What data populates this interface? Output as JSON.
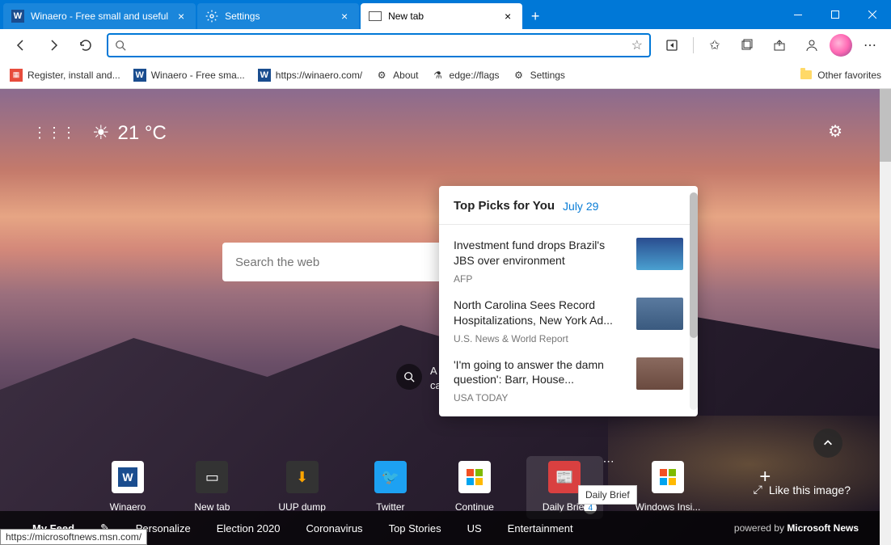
{
  "titlebar": {
    "tabs": [
      {
        "label": "Winaero - Free small and useful",
        "icon": "W"
      },
      {
        "label": "Settings",
        "icon": "gear"
      },
      {
        "label": "New tab",
        "icon": "page"
      }
    ],
    "newtab_plus": "+"
  },
  "toolbar": {
    "addrbar_placeholder": "",
    "addrbar_value": ""
  },
  "bookmarks": {
    "items": [
      {
        "icon": "grid",
        "label": "Register, install and..."
      },
      {
        "icon": "W",
        "label": "Winaero - Free sma..."
      },
      {
        "icon": "W",
        "label": "https://winaero.com/"
      },
      {
        "icon": "gear",
        "label": "About"
      },
      {
        "icon": "flask",
        "label": "edge://flags"
      },
      {
        "icon": "gear",
        "label": "Settings"
      }
    ],
    "other": "Other favorites"
  },
  "ntp": {
    "temperature": "21 °C",
    "search_placeholder": "Search the web",
    "image_credit": "A sparkling the sand call...",
    "like_label": "Like this image?"
  },
  "flyout": {
    "title": "Top Picks for You",
    "date": "July 29",
    "items": [
      {
        "headline": "Investment fund drops Brazil's JBS over environment",
        "source": "AFP"
      },
      {
        "headline": "North Carolina Sees Record Hospitalizations, New York Ad...",
        "source": "U.S. News & World Report"
      },
      {
        "headline": "'I'm going to answer the damn question': Barr, House...",
        "source": "USA TODAY"
      }
    ]
  },
  "tiles": [
    {
      "label": "Winaero"
    },
    {
      "label": "New tab"
    },
    {
      "label": "UUP dump"
    },
    {
      "label": "Twitter"
    },
    {
      "label": "Continue"
    },
    {
      "label": "Daily Brief",
      "badge": "4"
    },
    {
      "label": "Windows Insi..."
    }
  ],
  "tooltip": "Daily Brief",
  "bottom_nav": {
    "items": [
      "My Feed",
      "Personalize",
      "Election 2020",
      "Coronavirus",
      "Top Stories",
      "US",
      "Entertainment"
    ],
    "powered_prefix": "powered by",
    "powered_brand": "Microsoft News"
  },
  "statusbar": "https://microsoftnews.msn.com/"
}
